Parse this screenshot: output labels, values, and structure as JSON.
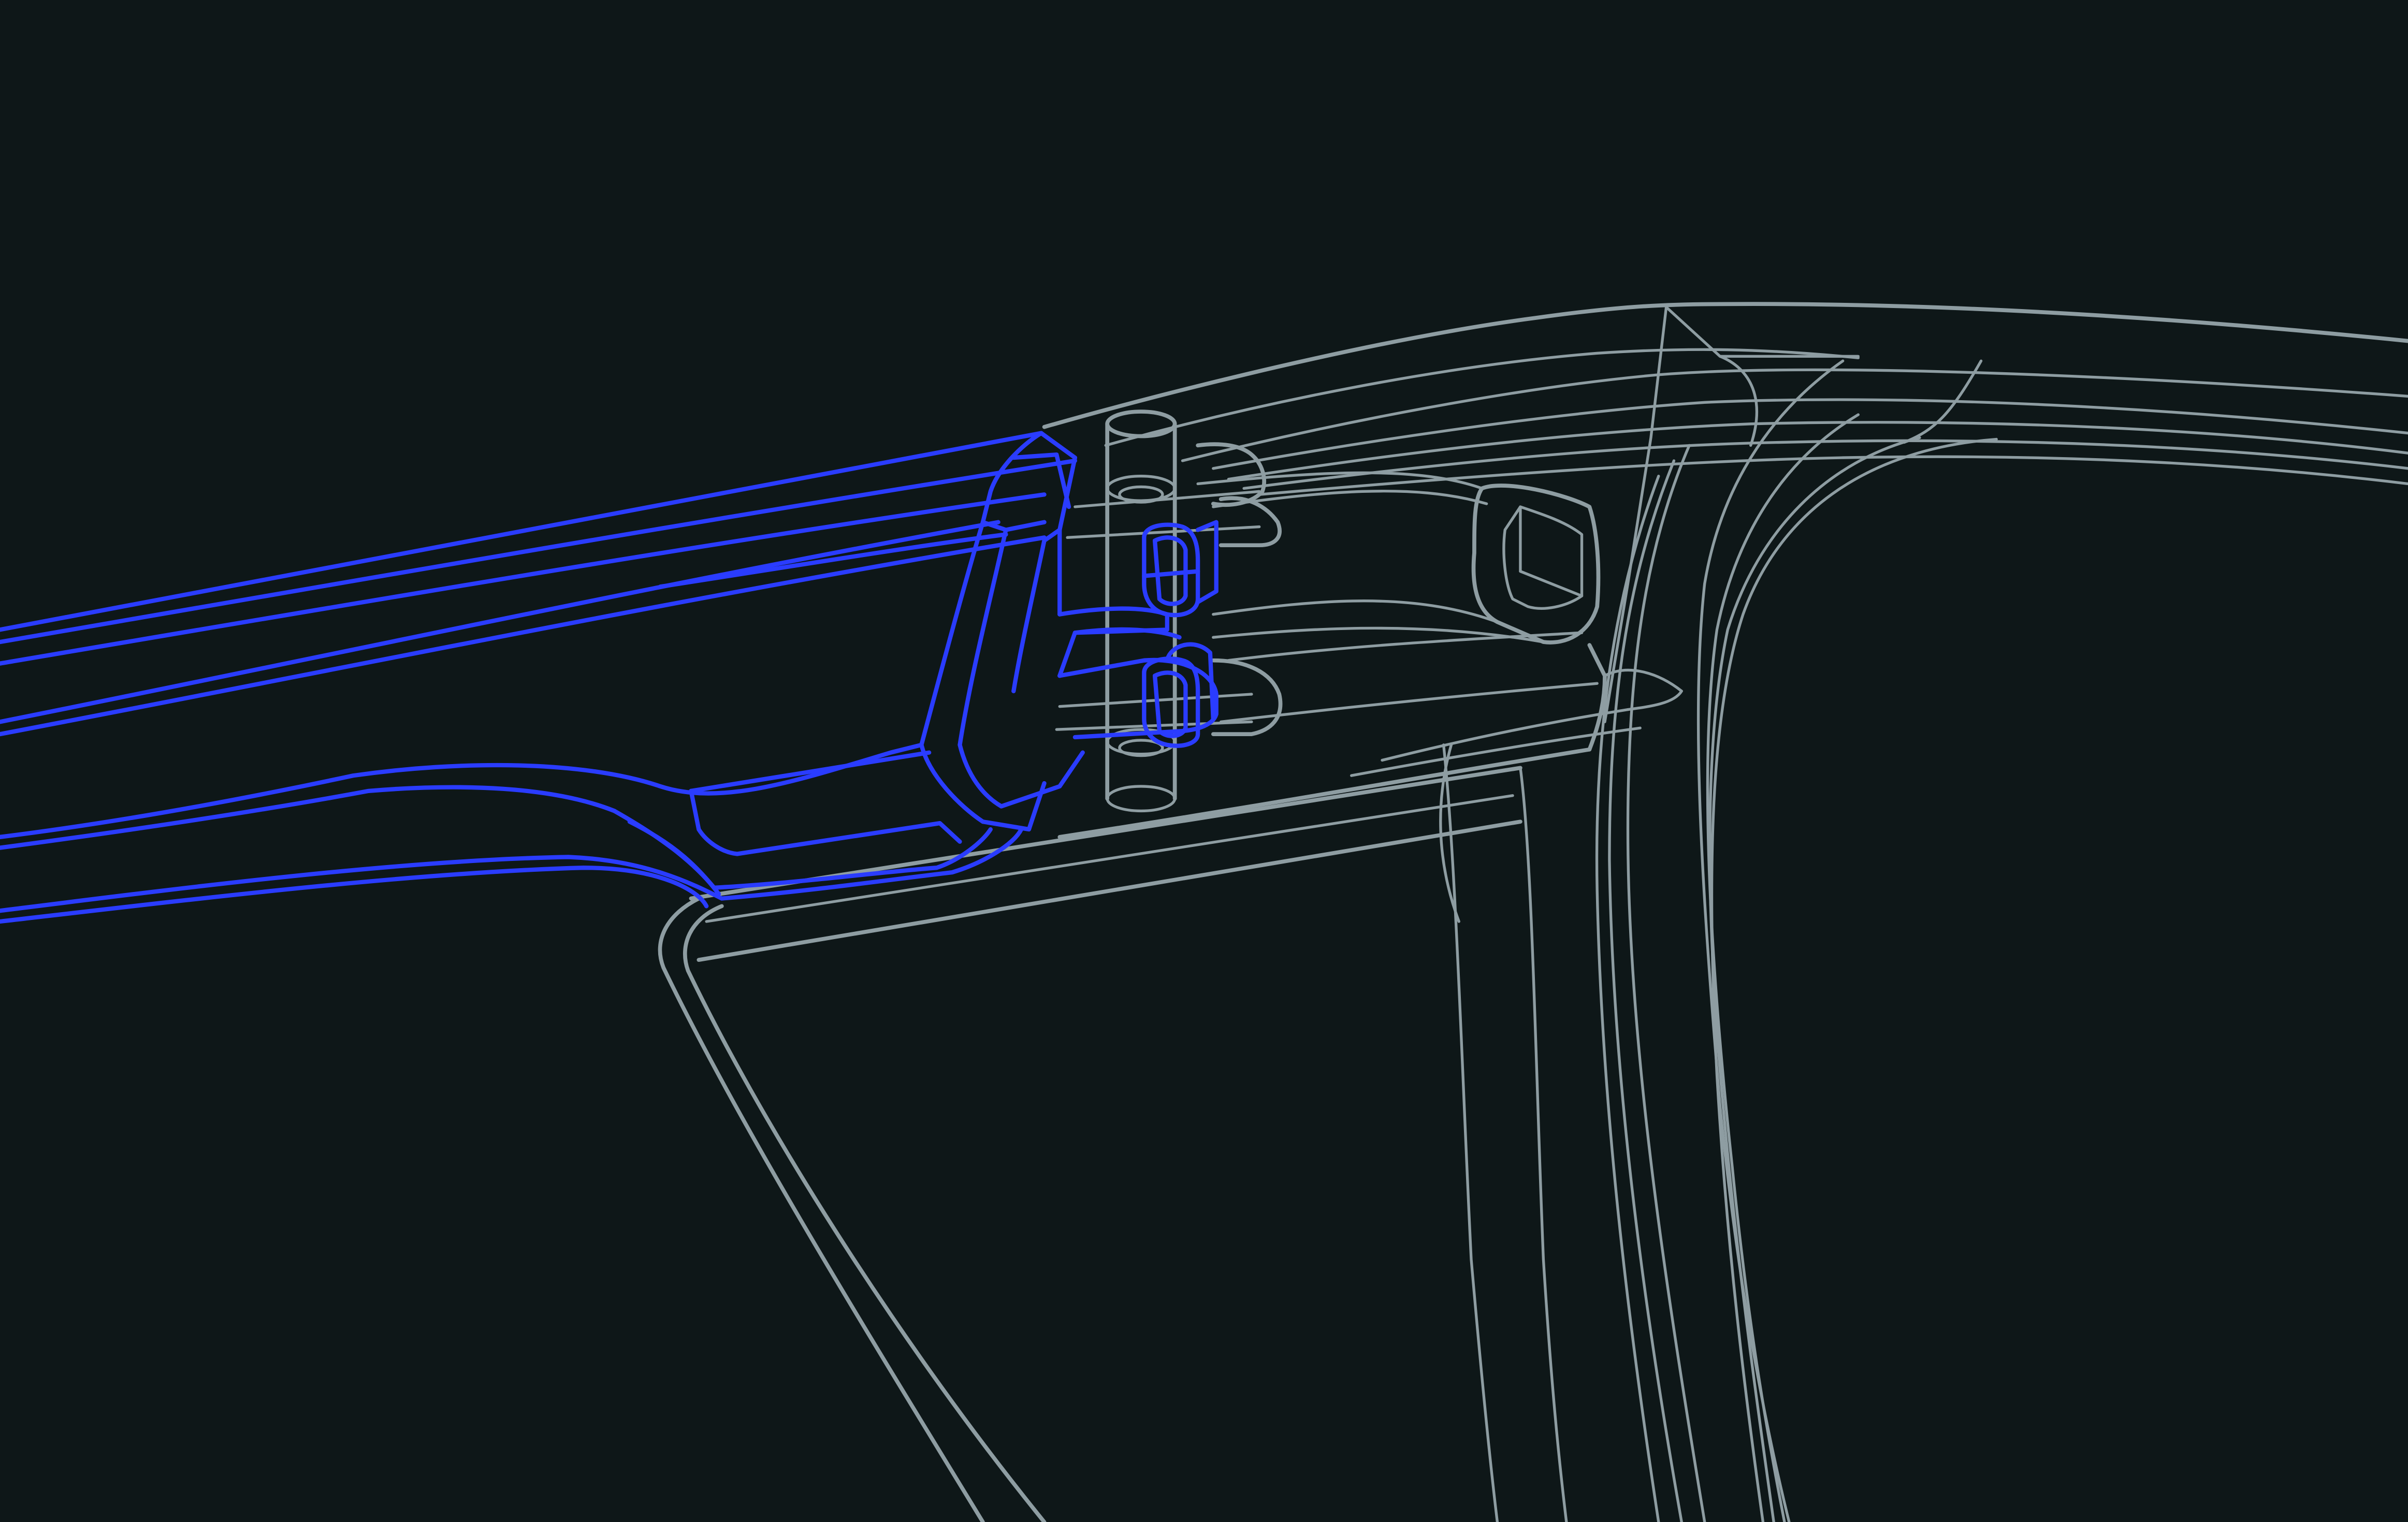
{
  "viewport": {
    "background_color": "#0e1718",
    "view_mode": "wireframe",
    "model": {
      "parts": [
        {
          "name": "front-frame",
          "state": "unselected",
          "edge_color": "#8e9da2"
        },
        {
          "name": "hinge-barrel",
          "state": "unselected",
          "edge_color": "#8e9da2"
        },
        {
          "name": "temple-arm",
          "state": "selected",
          "edge_color": "#2a3cff"
        }
      ]
    }
  }
}
